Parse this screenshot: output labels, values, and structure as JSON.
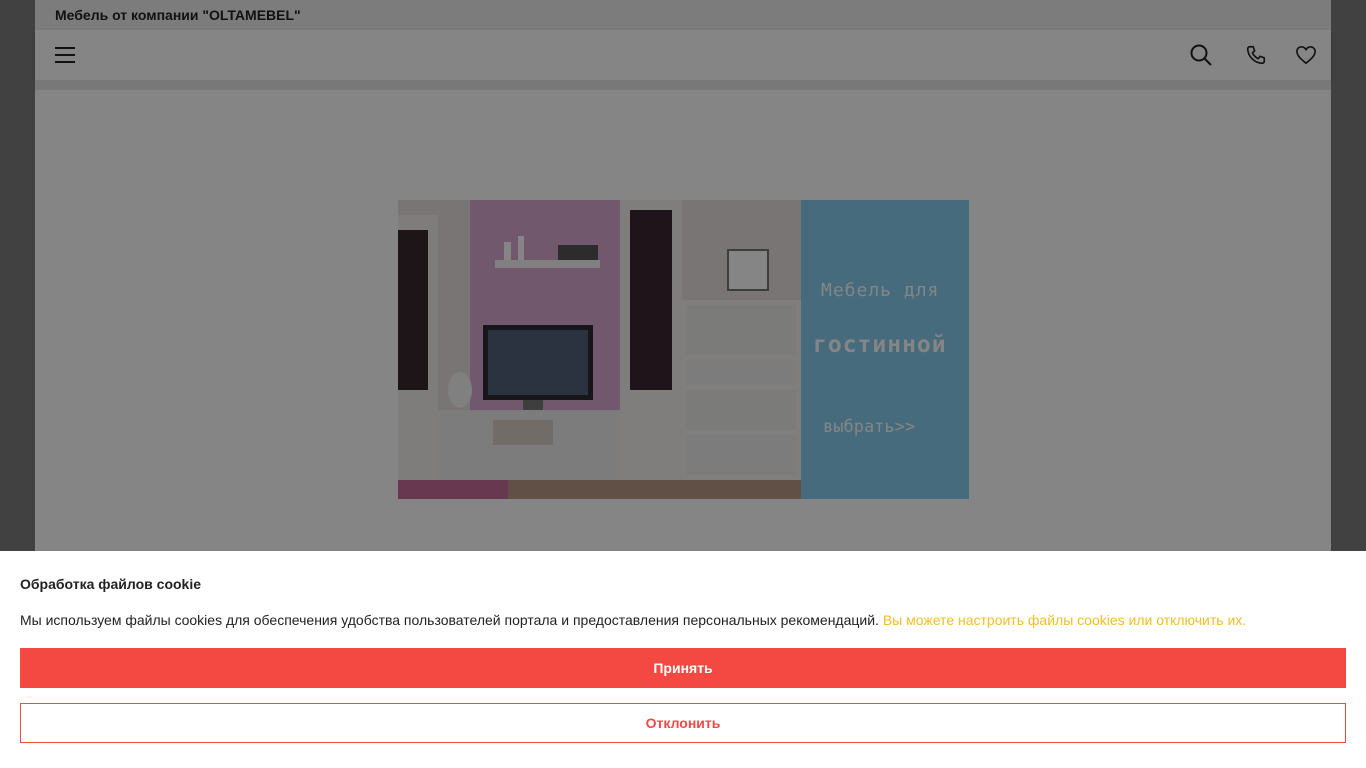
{
  "site": {
    "title": "Мебель от компании \"OLTAMEBEL\""
  },
  "header": {
    "icons": [
      "menu-icon",
      "search-icon",
      "phone-icon",
      "heart-icon"
    ]
  },
  "banner": {
    "line1": "Мебель для",
    "line2": "гостинной",
    "line3": "выбрать>>"
  },
  "cookie": {
    "title": "Обработка файлов cookie",
    "text": "Мы используем файлы cookies для обеспечения удобства пользователей портала и предоставления персональных рекомендаций.",
    "link": "Вы можете настроить файлы cookies или отключить их.",
    "accept": "Принять",
    "reject": "Отклонить"
  },
  "colors": {
    "accent": "#f44843",
    "link": "#f3bd25",
    "banner_blue": "#84cdef"
  }
}
